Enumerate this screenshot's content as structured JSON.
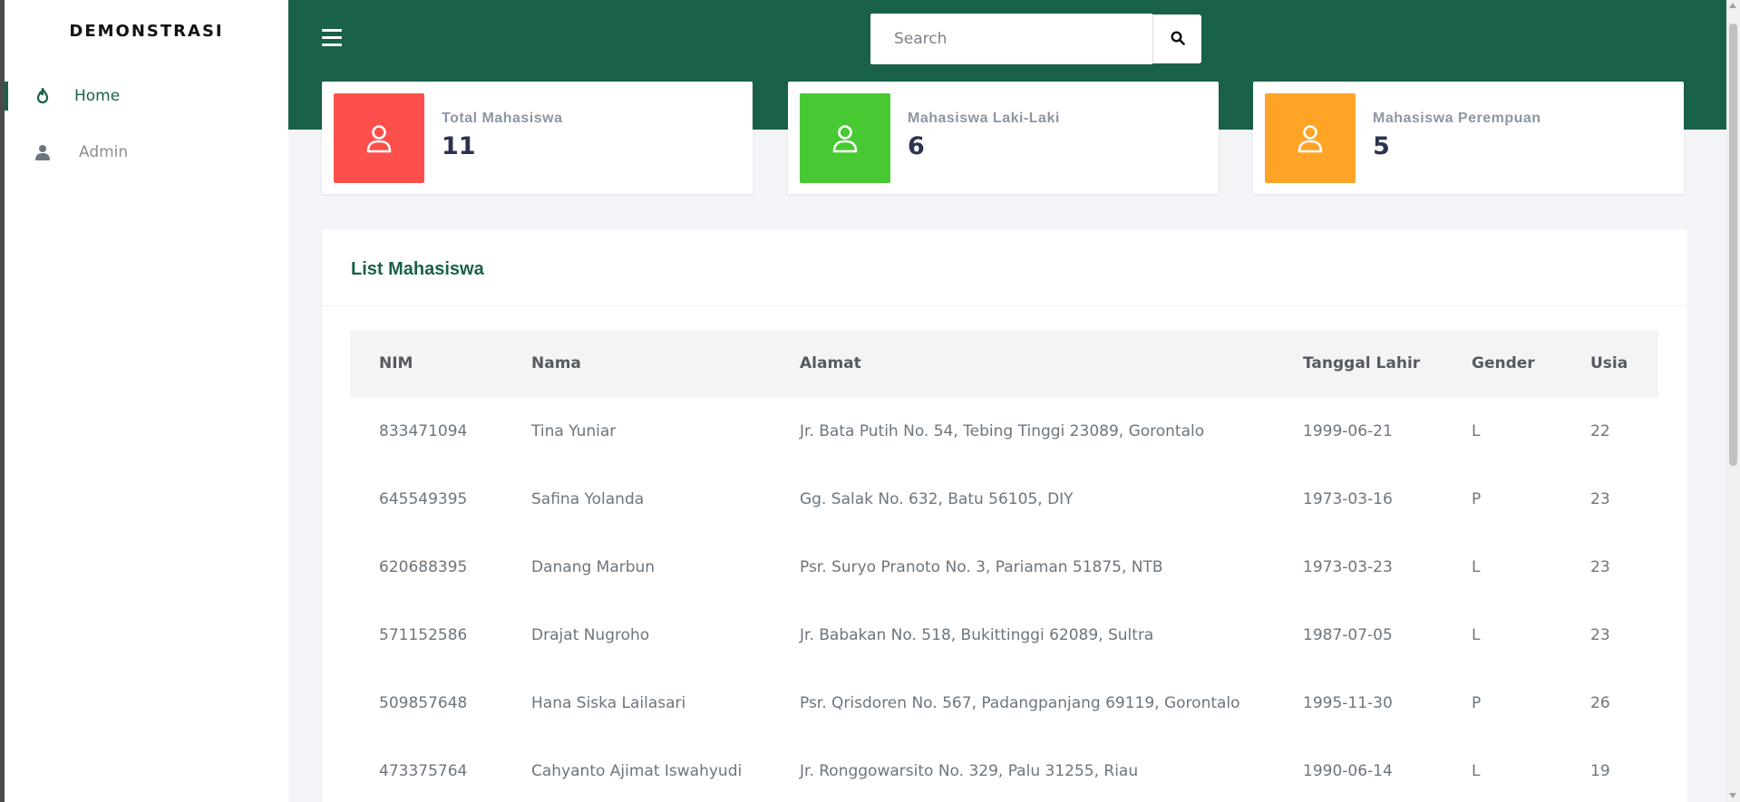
{
  "sidebar": {
    "brand": "DEMONSTRASI",
    "items": [
      {
        "label": "Home",
        "icon": "fire-icon",
        "active": true
      },
      {
        "label": "Admin",
        "icon": "user-icon",
        "active": false
      }
    ]
  },
  "header": {
    "search_placeholder": "Search",
    "search_value": ""
  },
  "stats": [
    {
      "label": "Total Mahasiswa",
      "value": "11",
      "color": "#fd504d",
      "icon": "user-outline-icon"
    },
    {
      "label": "Mahasiswa Laki-Laki",
      "value": "6",
      "color": "#48c933",
      "icon": "user-outline-icon"
    },
    {
      "label": "Mahasiswa Perempuan",
      "value": "5",
      "color": "#ffa426",
      "icon": "user-outline-icon"
    }
  ],
  "list": {
    "title": "List Mahasiswa",
    "columns": [
      "NIM",
      "Nama",
      "Alamat",
      "Tanggal Lahir",
      "Gender",
      "Usia"
    ],
    "rows": [
      [
        "833471094",
        "Tina Yuniar",
        "Jr. Bata Putih No. 54, Tebing Tinggi 23089, Gorontalo",
        "1999-06-21",
        "L",
        "22"
      ],
      [
        "645549395",
        "Safina Yolanda",
        "Gg. Salak No. 632, Batu 56105, DIY",
        "1973-03-16",
        "P",
        "23"
      ],
      [
        "620688395",
        "Danang Marbun",
        "Psr. Suryo Pranoto No. 3, Pariaman 51875, NTB",
        "1973-03-23",
        "L",
        "23"
      ],
      [
        "571152586",
        "Drajat Nugroho",
        "Jr. Babakan No. 518, Bukittinggi 62089, Sultra",
        "1987-07-05",
        "L",
        "23"
      ],
      [
        "509857648",
        "Hana Siska Lailasari",
        "Psr. Qrisdoren No. 567, Padangpanjang 69119, Gorontalo",
        "1995-11-30",
        "P",
        "26"
      ],
      [
        "473375764",
        "Cahyanto Ajimat Iswahyudi",
        "Jr. Ronggowarsito No. 329, Palu 31255, Riau",
        "1990-06-14",
        "L",
        "19"
      ]
    ]
  },
  "colors": {
    "accent": "#1a6149",
    "background": "#f3f4f8"
  }
}
